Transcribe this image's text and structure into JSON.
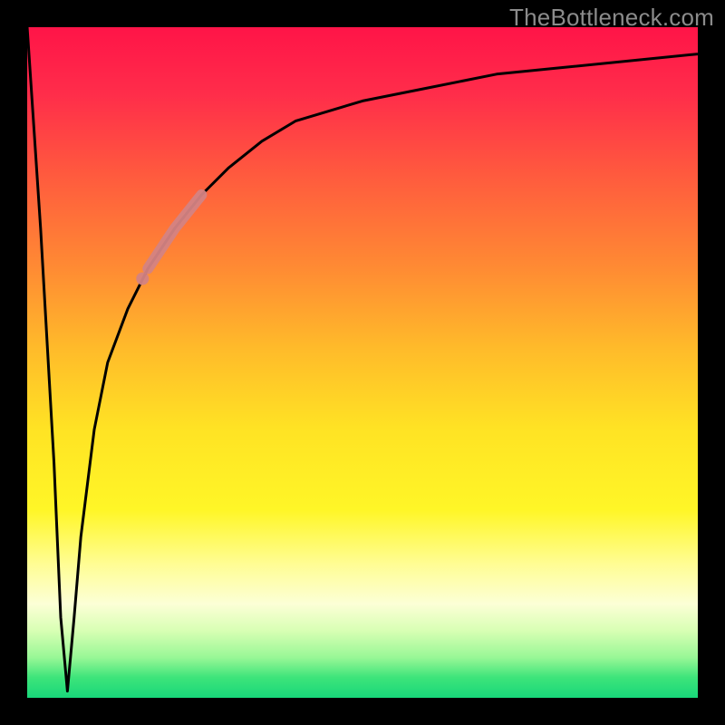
{
  "watermark": "TheBottleneck.com",
  "colors": {
    "black": "#000000",
    "curve": "#000000",
    "highlight": "#d48383",
    "gradient_stops": [
      "#ff1448",
      "#ff2d4a",
      "#ff5a3e",
      "#ff8b33",
      "#ffbb2a",
      "#ffe324",
      "#fff627",
      "#fffd93",
      "#fcffd6",
      "#d8ffb4",
      "#98f796",
      "#3de47a",
      "#18d77a"
    ]
  },
  "chart_data": {
    "type": "line",
    "title": "",
    "xlabel": "",
    "ylabel": "",
    "xlim": [
      0,
      100
    ],
    "ylim": [
      0,
      100
    ],
    "description": "Bottleneck curve: sharp V-notch near x≈6 dropping to ~0, then a steep logarithmic-style rise toward ~96 at the right edge. A salmon-colored highlight marks a short segment on the rising limb between roughly x=18 and x=26.",
    "series": [
      {
        "name": "bottleneck-curve",
        "x": [
          0,
          2,
          4,
          5,
          6,
          7,
          8,
          10,
          12,
          15,
          18,
          22,
          26,
          30,
          35,
          40,
          50,
          60,
          70,
          80,
          90,
          100
        ],
        "values": [
          100,
          70,
          35,
          12,
          1,
          12,
          24,
          40,
          50,
          58,
          64,
          70,
          75,
          79,
          83,
          86,
          89,
          91,
          93,
          94,
          95,
          96
        ]
      },
      {
        "name": "highlight-segment",
        "x": [
          18,
          20,
          22,
          24,
          26
        ],
        "values": [
          64,
          67,
          70,
          72.5,
          75
        ]
      },
      {
        "name": "highlight-dot",
        "x": [
          17.2
        ],
        "values": [
          62.5
        ]
      }
    ]
  }
}
